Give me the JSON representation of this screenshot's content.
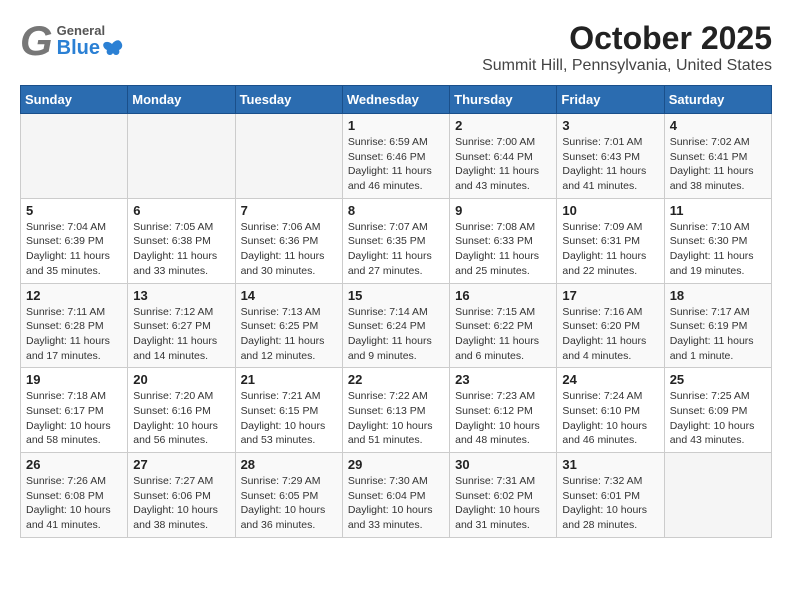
{
  "header": {
    "logo_general": "General",
    "logo_blue": "Blue",
    "title": "October 2025",
    "subtitle": "Summit Hill, Pennsylvania, United States"
  },
  "calendar": {
    "days_of_week": [
      "Sunday",
      "Monday",
      "Tuesday",
      "Wednesday",
      "Thursday",
      "Friday",
      "Saturday"
    ],
    "weeks": [
      [
        {
          "day": "",
          "info": ""
        },
        {
          "day": "",
          "info": ""
        },
        {
          "day": "",
          "info": ""
        },
        {
          "day": "1",
          "info": "Sunrise: 6:59 AM\nSunset: 6:46 PM\nDaylight: 11 hours and 46 minutes."
        },
        {
          "day": "2",
          "info": "Sunrise: 7:00 AM\nSunset: 6:44 PM\nDaylight: 11 hours and 43 minutes."
        },
        {
          "day": "3",
          "info": "Sunrise: 7:01 AM\nSunset: 6:43 PM\nDaylight: 11 hours and 41 minutes."
        },
        {
          "day": "4",
          "info": "Sunrise: 7:02 AM\nSunset: 6:41 PM\nDaylight: 11 hours and 38 minutes."
        }
      ],
      [
        {
          "day": "5",
          "info": "Sunrise: 7:04 AM\nSunset: 6:39 PM\nDaylight: 11 hours and 35 minutes."
        },
        {
          "day": "6",
          "info": "Sunrise: 7:05 AM\nSunset: 6:38 PM\nDaylight: 11 hours and 33 minutes."
        },
        {
          "day": "7",
          "info": "Sunrise: 7:06 AM\nSunset: 6:36 PM\nDaylight: 11 hours and 30 minutes."
        },
        {
          "day": "8",
          "info": "Sunrise: 7:07 AM\nSunset: 6:35 PM\nDaylight: 11 hours and 27 minutes."
        },
        {
          "day": "9",
          "info": "Sunrise: 7:08 AM\nSunset: 6:33 PM\nDaylight: 11 hours and 25 minutes."
        },
        {
          "day": "10",
          "info": "Sunrise: 7:09 AM\nSunset: 6:31 PM\nDaylight: 11 hours and 22 minutes."
        },
        {
          "day": "11",
          "info": "Sunrise: 7:10 AM\nSunset: 6:30 PM\nDaylight: 11 hours and 19 minutes."
        }
      ],
      [
        {
          "day": "12",
          "info": "Sunrise: 7:11 AM\nSunset: 6:28 PM\nDaylight: 11 hours and 17 minutes."
        },
        {
          "day": "13",
          "info": "Sunrise: 7:12 AM\nSunset: 6:27 PM\nDaylight: 11 hours and 14 minutes."
        },
        {
          "day": "14",
          "info": "Sunrise: 7:13 AM\nSunset: 6:25 PM\nDaylight: 11 hours and 12 minutes."
        },
        {
          "day": "15",
          "info": "Sunrise: 7:14 AM\nSunset: 6:24 PM\nDaylight: 11 hours and 9 minutes."
        },
        {
          "day": "16",
          "info": "Sunrise: 7:15 AM\nSunset: 6:22 PM\nDaylight: 11 hours and 6 minutes."
        },
        {
          "day": "17",
          "info": "Sunrise: 7:16 AM\nSunset: 6:20 PM\nDaylight: 11 hours and 4 minutes."
        },
        {
          "day": "18",
          "info": "Sunrise: 7:17 AM\nSunset: 6:19 PM\nDaylight: 11 hours and 1 minute."
        }
      ],
      [
        {
          "day": "19",
          "info": "Sunrise: 7:18 AM\nSunset: 6:17 PM\nDaylight: 10 hours and 58 minutes."
        },
        {
          "day": "20",
          "info": "Sunrise: 7:20 AM\nSunset: 6:16 PM\nDaylight: 10 hours and 56 minutes."
        },
        {
          "day": "21",
          "info": "Sunrise: 7:21 AM\nSunset: 6:15 PM\nDaylight: 10 hours and 53 minutes."
        },
        {
          "day": "22",
          "info": "Sunrise: 7:22 AM\nSunset: 6:13 PM\nDaylight: 10 hours and 51 minutes."
        },
        {
          "day": "23",
          "info": "Sunrise: 7:23 AM\nSunset: 6:12 PM\nDaylight: 10 hours and 48 minutes."
        },
        {
          "day": "24",
          "info": "Sunrise: 7:24 AM\nSunset: 6:10 PM\nDaylight: 10 hours and 46 minutes."
        },
        {
          "day": "25",
          "info": "Sunrise: 7:25 AM\nSunset: 6:09 PM\nDaylight: 10 hours and 43 minutes."
        }
      ],
      [
        {
          "day": "26",
          "info": "Sunrise: 7:26 AM\nSunset: 6:08 PM\nDaylight: 10 hours and 41 minutes."
        },
        {
          "day": "27",
          "info": "Sunrise: 7:27 AM\nSunset: 6:06 PM\nDaylight: 10 hours and 38 minutes."
        },
        {
          "day": "28",
          "info": "Sunrise: 7:29 AM\nSunset: 6:05 PM\nDaylight: 10 hours and 36 minutes."
        },
        {
          "day": "29",
          "info": "Sunrise: 7:30 AM\nSunset: 6:04 PM\nDaylight: 10 hours and 33 minutes."
        },
        {
          "day": "30",
          "info": "Sunrise: 7:31 AM\nSunset: 6:02 PM\nDaylight: 10 hours and 31 minutes."
        },
        {
          "day": "31",
          "info": "Sunrise: 7:32 AM\nSunset: 6:01 PM\nDaylight: 10 hours and 28 minutes."
        },
        {
          "day": "",
          "info": ""
        }
      ]
    ]
  }
}
